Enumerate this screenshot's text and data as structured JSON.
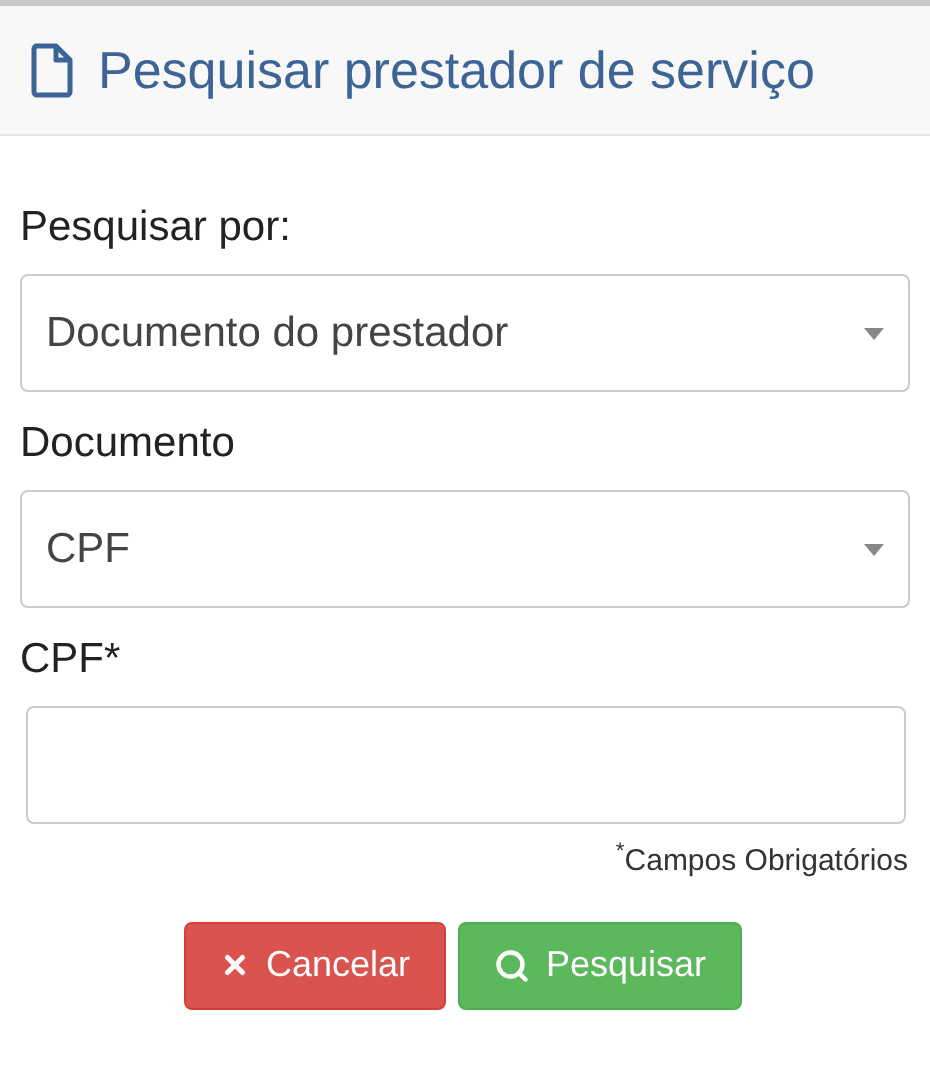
{
  "header": {
    "title": "Pesquisar prestador de serviço"
  },
  "fields": [
    {
      "kind": "select",
      "label": "Pesquisar por:",
      "value": "Documento do prestador"
    },
    {
      "kind": "select",
      "label": "Documento",
      "value": "CPF"
    },
    {
      "kind": "text",
      "label": "CPF*"
    }
  ],
  "required_note": "$^{*}$Campos Obrigatórios",
  "buttons": [
    {
      "kind": "cancel",
      "label": "Cancelar"
    },
    {
      "kind": "search",
      "label": "Pesquisar"
    }
  ]
}
